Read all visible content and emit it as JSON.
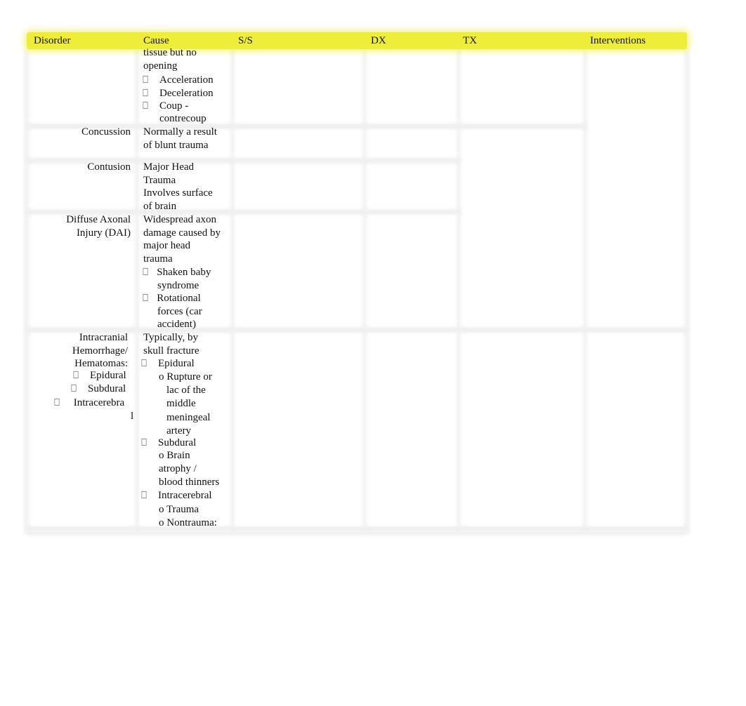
{
  "table": {
    "headers": [
      "Disorder",
      "Cause",
      "S/S",
      "DX",
      "TX",
      "Interventions"
    ],
    "header_color": "#eeee3a",
    "rows": [
      {
        "disorder": [],
        "cause": [
          "tissue but no",
          "opening"
        ],
        "cause_bullets": [
          "Acceleration",
          "Deceleration",
          "Coup -",
          "contrecoup"
        ]
      },
      {
        "disorder": [
          "Concussion"
        ],
        "cause": [
          "Normally a result",
          "of blunt trauma"
        ]
      },
      {
        "disorder": [
          "Contusion"
        ],
        "cause": [
          "Major Head",
          "Trauma",
          "Involves surface",
          "of brain"
        ]
      },
      {
        "disorder": [
          "Diffuse Axonal",
          "Injury (DAI)"
        ],
        "cause": [
          "Widespread axon",
          "damage caused by",
          "major head",
          "trauma"
        ],
        "cause_bullets": [
          "Shaken baby",
          "syndrome",
          "Rotational",
          "forces (car",
          "accident)"
        ]
      },
      {
        "disorder": [
          "Intracranial",
          "Hemorrhage/",
          "Hematomas:"
        ],
        "disorder_bullets": [
          "Epidural",
          "Subdural",
          "Intracerebra",
          "l"
        ],
        "cause": [
          "Typically, by",
          "skull fracture"
        ],
        "cause_items": [
          {
            "bullet": "Epidural",
            "subs": [
              "o Rupture or",
              "lac of the",
              "middle",
              "meningeal",
              "artery"
            ]
          },
          {
            "bullet": "Subdural",
            "subs": [
              "o Brain",
              "atrophy /",
              "blood thinners"
            ]
          },
          {
            "bullet": "Intracerebral",
            "subs": [
              "o Trauma",
              "o Nontrauma:"
            ]
          }
        ]
      }
    ]
  },
  "icons": {
    "bullet": "missing-glyph-box"
  }
}
